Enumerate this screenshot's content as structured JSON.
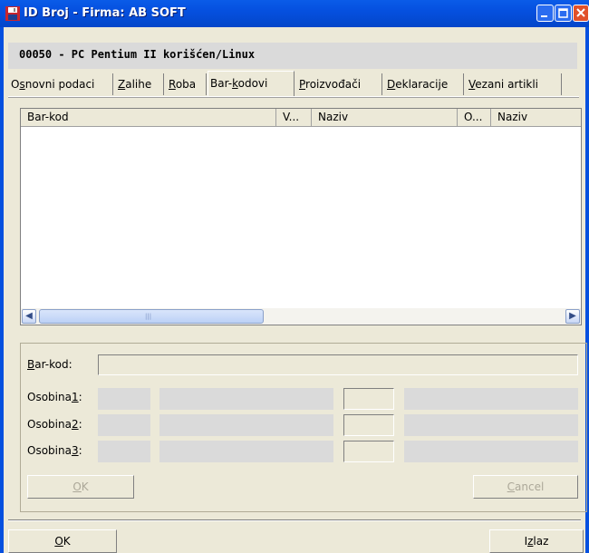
{
  "window": {
    "title": "ID Broj - Firma: AB SOFT",
    "app_icon": "floppy-icon",
    "controls": [
      "minimize-icon",
      "maximize-icon",
      "close-icon"
    ]
  },
  "record": {
    "title": "00050 - PC Pentium II korišćen/Linux"
  },
  "tabs": [
    {
      "pre": "O",
      "key": "s",
      "post": "novni podaci",
      "active": false
    },
    {
      "pre": "",
      "key": "Z",
      "post": "alihe",
      "active": false
    },
    {
      "pre": "",
      "key": "R",
      "post": "oba",
      "active": false
    },
    {
      "pre": "Bar-",
      "key": "k",
      "post": "odovi",
      "active": true
    },
    {
      "pre": "",
      "key": "P",
      "post": "roizvođači",
      "active": false
    },
    {
      "pre": "",
      "key": "D",
      "post": "eklaracije",
      "active": false
    },
    {
      "pre": "",
      "key": "V",
      "post": "ezani artikli",
      "active": false
    }
  ],
  "grid": {
    "columns": [
      "Bar-kod",
      "V...",
      "Naziv",
      "O...",
      "Naziv"
    ],
    "rows": [],
    "scroll_grip": "|||"
  },
  "form": {
    "barcode": {
      "key": "B",
      "rest": "ar-kod:",
      "value": ""
    },
    "attributes": [
      {
        "pre": "Osobina",
        "key": "1",
        "post": ":"
      },
      {
        "pre": "Osobina",
        "key": "2",
        "post": ":"
      },
      {
        "pre": "Osobina",
        "key": "3",
        "post": ":"
      }
    ],
    "ok": {
      "key": "O",
      "rest": "K",
      "enabled": false
    },
    "cancel": {
      "key": "C",
      "rest": "ancel",
      "enabled": false
    }
  },
  "footer": {
    "ok": {
      "key": "O",
      "rest": "K"
    },
    "exit": {
      "pre": "I",
      "key": "z",
      "post": "laz"
    }
  }
}
